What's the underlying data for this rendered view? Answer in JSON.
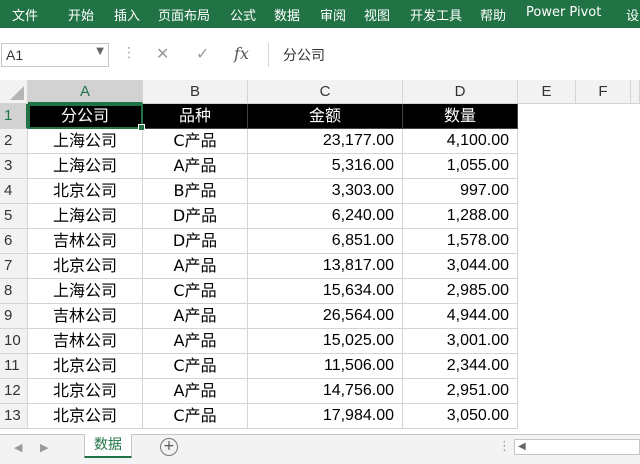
{
  "ribbon": {
    "tabs": [
      "文件",
      "开始",
      "插入",
      "页面布局",
      "公式",
      "数据",
      "审阅",
      "视图",
      "开发工具",
      "帮助",
      "Power Pivot",
      "设"
    ]
  },
  "formula_bar": {
    "name_box": "A1",
    "cancel_icon": "✕",
    "enter_icon": "✓",
    "fx_label": "fx",
    "content": "分公司"
  },
  "columns": [
    "A",
    "B",
    "C",
    "D",
    "E",
    "F"
  ],
  "rows": [
    "1",
    "2",
    "3",
    "4",
    "5",
    "6",
    "7",
    "8",
    "9",
    "10",
    "11",
    "12",
    "13"
  ],
  "header_row": [
    "分公司",
    "品种",
    "金额",
    "数量"
  ],
  "data_rows": [
    [
      "上海公司",
      "C产品",
      "23,177.00",
      "4,100.00"
    ],
    [
      "上海公司",
      "A产品",
      "5,316.00",
      "1,055.00"
    ],
    [
      "北京公司",
      "B产品",
      "3,303.00",
      "997.00"
    ],
    [
      "上海公司",
      "D产品",
      "6,240.00",
      "1,288.00"
    ],
    [
      "吉林公司",
      "D产品",
      "6,851.00",
      "1,578.00"
    ],
    [
      "北京公司",
      "A产品",
      "13,817.00",
      "3,044.00"
    ],
    [
      "上海公司",
      "C产品",
      "15,634.00",
      "2,985.00"
    ],
    [
      "吉林公司",
      "A产品",
      "26,564.00",
      "4,944.00"
    ],
    [
      "吉林公司",
      "A产品",
      "15,025.00",
      "3,001.00"
    ],
    [
      "北京公司",
      "C产品",
      "11,506.00",
      "2,344.00"
    ],
    [
      "北京公司",
      "A产品",
      "14,756.00",
      "2,951.00"
    ],
    [
      "北京公司",
      "C产品",
      "17,984.00",
      "3,050.00"
    ]
  ],
  "sheet_tabs": {
    "active": "数据",
    "add_label": "+"
  },
  "colors": {
    "accent": "#217346",
    "header_fill": "#000000",
    "header_text": "#ffffff"
  }
}
